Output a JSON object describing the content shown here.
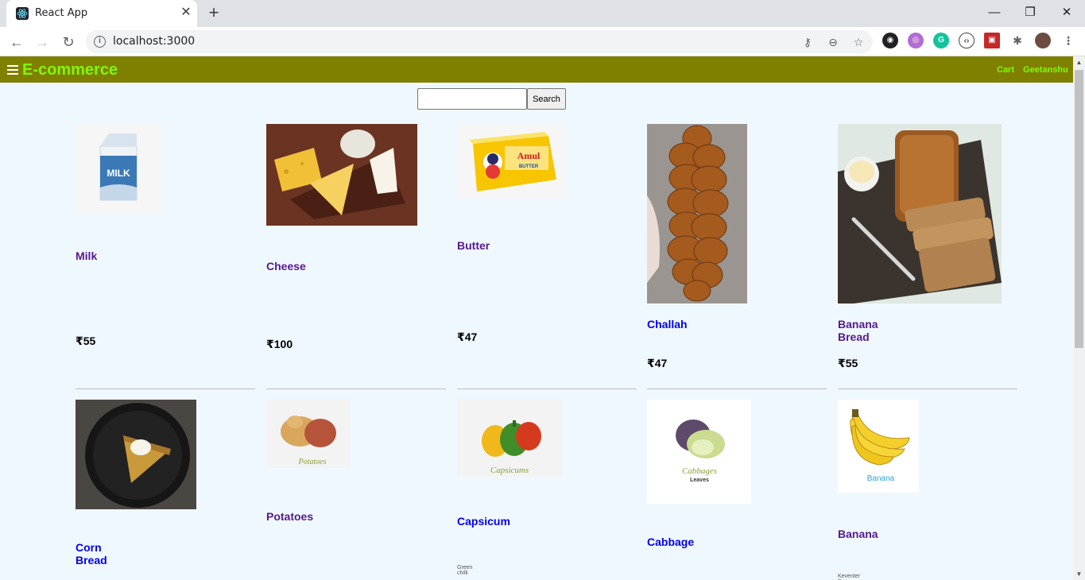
{
  "browser": {
    "tab_title": "React App",
    "url": "localhost:3000"
  },
  "navbar": {
    "brand": "E-commerce",
    "links": [
      "Cart",
      "Geetanshu"
    ],
    "bg_color": "#808000",
    "text_color": "#7cfc00"
  },
  "search": {
    "placeholder": "",
    "button_label": "Search"
  },
  "products": [
    {
      "name": "Milk",
      "price": "₹55",
      "visited": true
    },
    {
      "name": "Cheese",
      "price": "₹100",
      "visited": true
    },
    {
      "name": "Butter",
      "price": "₹47",
      "visited": true
    },
    {
      "name": "Challah",
      "price": "₹47",
      "visited": false
    },
    {
      "name": "Banana Bread",
      "price": "₹55",
      "visited": true
    },
    {
      "name": "Corn Bread",
      "visited": false
    },
    {
      "name": "Potatoes",
      "visited": true
    },
    {
      "name": "Capsicum",
      "subtext": "Green chilli",
      "visited": false
    },
    {
      "name": "Cabbage",
      "visited": false
    },
    {
      "name": "Banana",
      "subtext": "Keventer Bananas",
      "visited": true
    }
  ],
  "image_labels": {
    "milk": "MILK",
    "butter_brand": "Amul",
    "butter_sub": "BUTTER",
    "potatoes": "Potatoes",
    "capsicums": "Capsicums",
    "cabbages": "Cabbages",
    "cabbages_sub": "Leaves",
    "banana": "Banana"
  }
}
